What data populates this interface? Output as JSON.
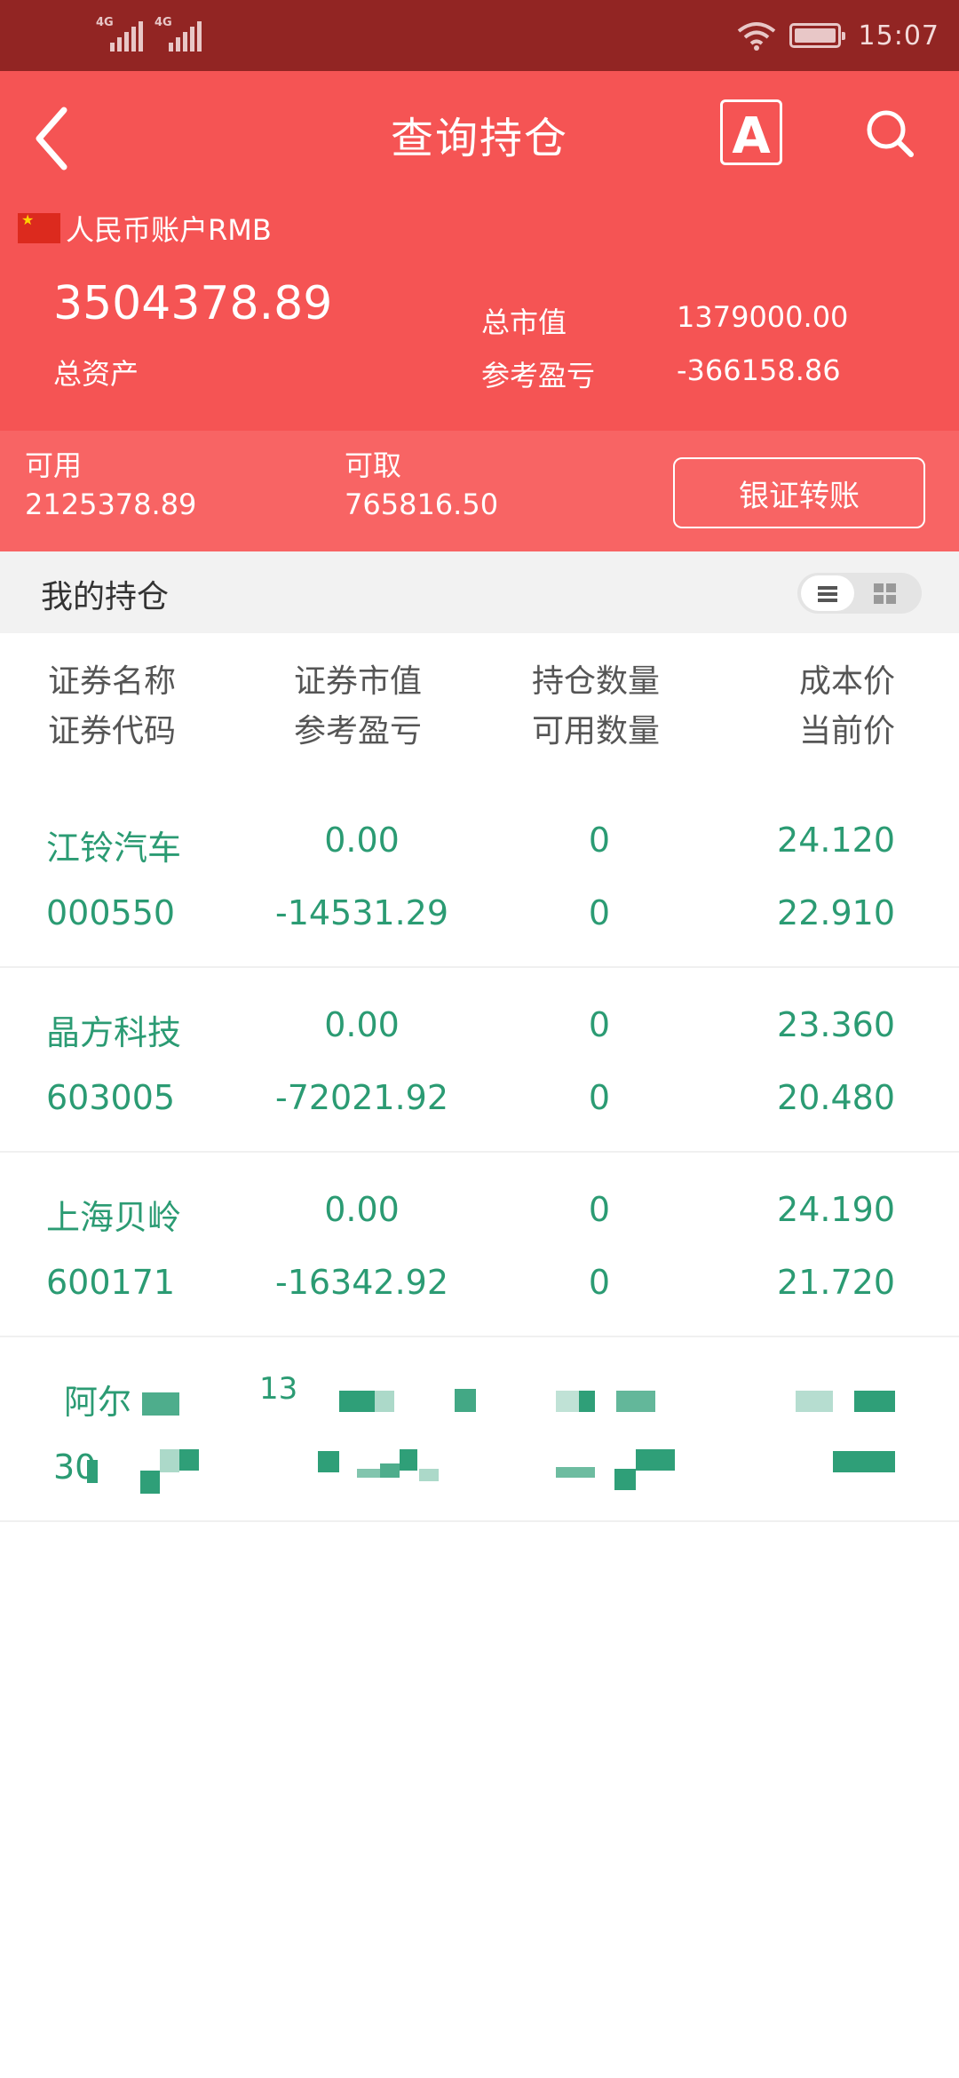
{
  "status_bar": {
    "sim1_type": "4G",
    "sim2_type": "4G",
    "time": "15:07",
    "colors": {
      "background": "#922523"
    }
  },
  "header": {
    "title": "查询持仓",
    "back_icon": "back-chevron-icon",
    "font_icon": "font-size-icon",
    "font_icon_letter": "A",
    "search_icon": "search-icon",
    "account_label": "人民币账户RMB",
    "flag_icon": "china-flag-icon",
    "total_assets_value": "3504378.89",
    "total_assets_label": "总资产",
    "market_value_label": "总市值",
    "market_value": "1379000.00",
    "ref_pl_label": "参考盈亏",
    "ref_pl_value": "-366158.86",
    "colors": {
      "background": "#f55454"
    }
  },
  "available": {
    "usable_label": "可用",
    "usable_value": "2125378.89",
    "withdrawable_label": "可取",
    "withdrawable_value": "765816.50",
    "transfer_button": "银证转账"
  },
  "holdings": {
    "title": "我的持仓",
    "list_view_icon": "list-view-icon",
    "grid_view_icon": "grid-view-icon",
    "columns": [
      {
        "top": "证券名称",
        "bottom": "证券代码"
      },
      {
        "top": "证券市值",
        "bottom": "参考盈亏"
      },
      {
        "top": "持仓数量",
        "bottom": "可用数量"
      },
      {
        "top": "成本价",
        "bottom": "当前价"
      }
    ],
    "rows": [
      {
        "name": "江铃汽车",
        "code": "000550",
        "market_value": "0.00",
        "ref_pl": "-14531.29",
        "hold_qty": "0",
        "avail_qty": "0",
        "cost_price": "24.120",
        "current_price": "22.910"
      },
      {
        "name": "晶方科技",
        "code": "603005",
        "market_value": "0.00",
        "ref_pl": "-72021.92",
        "hold_qty": "0",
        "avail_qty": "0",
        "cost_price": "23.360",
        "current_price": "20.480"
      },
      {
        "name": "上海贝岭",
        "code": "600171",
        "market_value": "0.00",
        "ref_pl": "-16342.92",
        "hold_qty": "0",
        "avail_qty": "0",
        "cost_price": "24.190",
        "current_price": "21.720"
      }
    ],
    "redacted_row": {
      "name_visible": "阿尔",
      "value_visible": "13",
      "code_visible": "30"
    },
    "colors": {
      "value_text": "#2b9b73"
    }
  }
}
